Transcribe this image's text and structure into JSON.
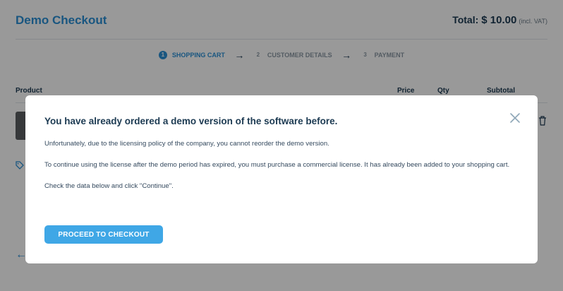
{
  "header": {
    "brand": "Demo Checkout",
    "total_label": "Total:",
    "total_amount": "$ 10.00",
    "total_vat": "(incl. VAT)"
  },
  "steps": [
    {
      "num": "1",
      "label": "SHOPPING CART",
      "active": true
    },
    {
      "num": "2",
      "label": "CUSTOMER DETAILS",
      "active": false
    },
    {
      "num": "3",
      "label": "PAYMENT",
      "active": false
    }
  ],
  "table": {
    "columns": [
      "Product",
      "Price",
      "Qty",
      "Subtotal"
    ]
  },
  "modal": {
    "title": "You have already ordered a demo version of the software before.",
    "paragraph1": "Unfortunately, due to the licensing policy of the company, you cannot reorder the demo version.",
    "paragraph2": "To continue using the license after the demo period has expired, you must purchase a commercial license. It has already been added to your shopping cart.",
    "paragraph3": "Check the data below and click \"Continue\".",
    "button_label": "PROCEED TO CHECKOUT",
    "close_icon": "close-icon"
  },
  "colors": {
    "brand": "#2a8fd6",
    "button": "#3fa7e6",
    "overlay": "rgba(0,0,0,0.40)"
  }
}
